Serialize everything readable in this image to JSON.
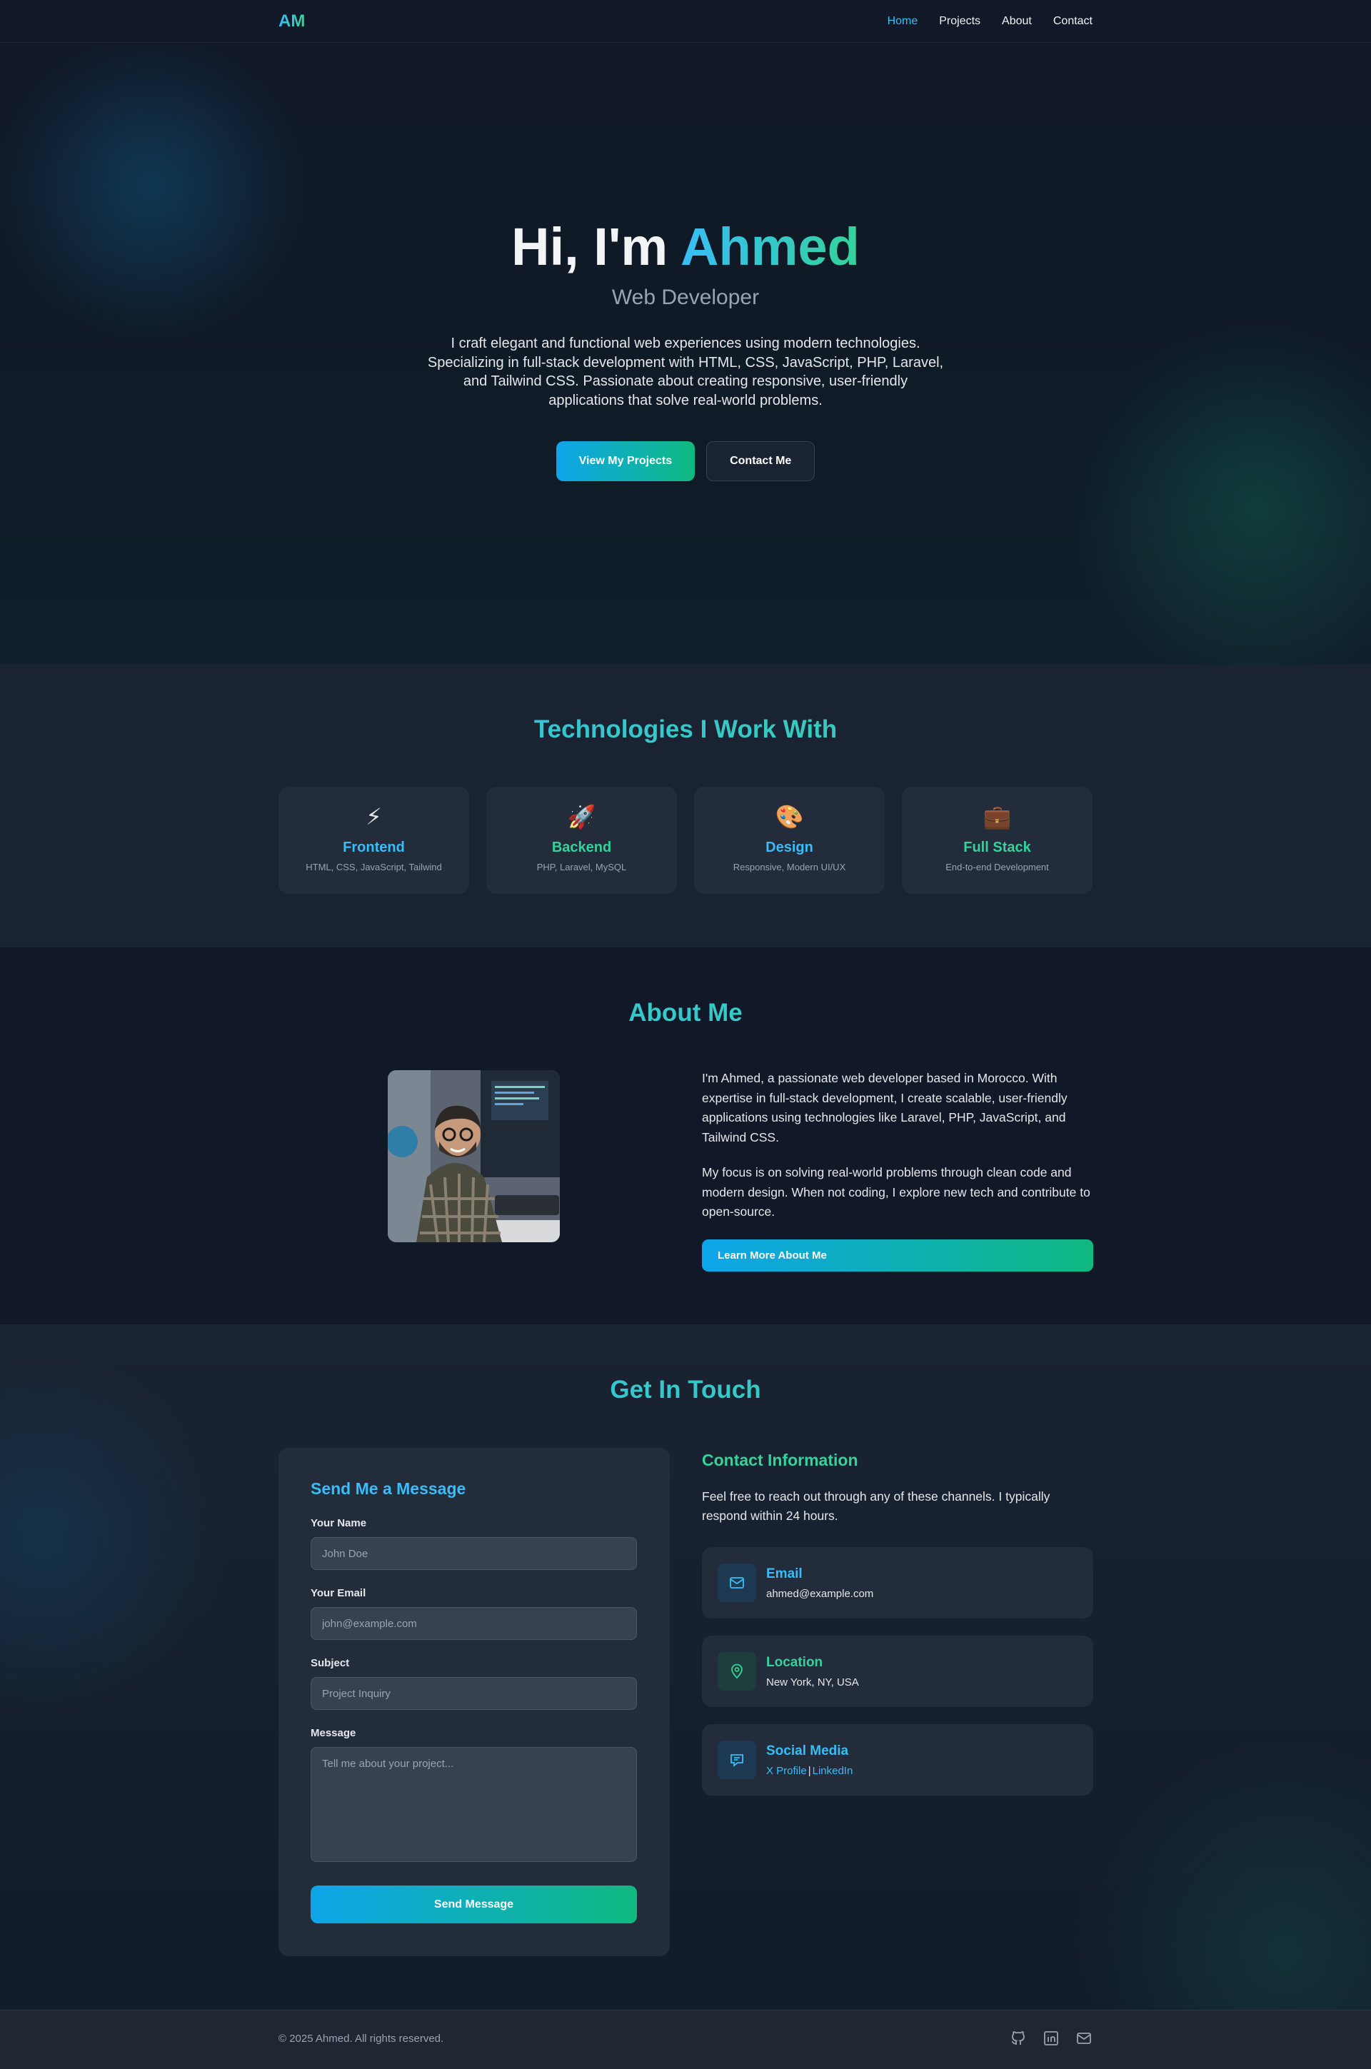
{
  "nav": {
    "logo": "AM",
    "links": [
      {
        "label": "Home",
        "active": true
      },
      {
        "label": "Projects",
        "active": false
      },
      {
        "label": "About",
        "active": false
      },
      {
        "label": "Contact",
        "active": false
      }
    ]
  },
  "hero": {
    "greeting": "Hi, I'm ",
    "name": "Ahmed",
    "role": "Web Developer",
    "intro": "I craft elegant and functional web experiences using modern technologies. Specializing in full-stack development with HTML, CSS, JavaScript, PHP, Laravel, and Tailwind CSS. Passionate about creating responsive, user-friendly applications that solve real-world problems.",
    "primary_button": "View My Projects",
    "secondary_button": "Contact Me"
  },
  "tech": {
    "title": "Technologies I Work With",
    "cards": [
      {
        "icon": "lightning-icon",
        "glyph": "⚡",
        "name": "Frontend",
        "desc": "HTML, CSS, JavaScript, Tailwind",
        "color": "#38bdf8"
      },
      {
        "icon": "rocket-icon",
        "glyph": "🚀",
        "name": "Backend",
        "desc": "PHP, Laravel, MySQL",
        "color": "#34d399"
      },
      {
        "icon": "palette-icon",
        "glyph": "🎨",
        "name": "Design",
        "desc": "Responsive, Modern UI/UX",
        "color": "#38bdf8"
      },
      {
        "icon": "briefcase-icon",
        "glyph": "💼",
        "name": "Full Stack",
        "desc": "End-to-end Development",
        "color": "#34d399"
      }
    ]
  },
  "about": {
    "title": "About Me",
    "paragraph_1": "I'm Ahmed, a passionate web developer based in Morocco. With expertise in full-stack development, I create scalable, user-friendly applications using technologies like Laravel, PHP, JavaScript, and Tailwind CSS.",
    "paragraph_2": "My focus is on solving real-world problems through clean code and modern design. When not coding, I explore new tech and contribute to open-source.",
    "button": "Learn More About Me"
  },
  "contact": {
    "title": "Get In Touch",
    "form": {
      "title": "Send Me a Message",
      "name_label": "Your Name",
      "name_placeholder": "John Doe",
      "email_label": "Your Email",
      "email_placeholder": "john@example.com",
      "subject_label": "Subject",
      "subject_placeholder": "Project Inquiry",
      "message_label": "Message",
      "message_placeholder": "Tell me about your project...",
      "submit": "Send Message"
    },
    "info": {
      "title": "Contact Information",
      "desc": "Feel free to reach out through any of these channels. I typically respond within 24 hours.",
      "email_title": "Email",
      "email_value": "ahmed@example.com",
      "location_title": "Location",
      "location_value": "New York, NY, USA",
      "social_title": "Social Media",
      "social_link_1": "X Profile",
      "social_sep": "|",
      "social_link_2": "LinkedIn"
    }
  },
  "footer": {
    "copyright": "© 2025 Ahmed. All rights reserved.",
    "icons": [
      "github-icon",
      "linkedin-icon",
      "mail-icon"
    ]
  },
  "colors": {
    "accent_blue": "#38bdf8",
    "accent_green": "#34d399",
    "background": "#111827",
    "card": "#232c3b"
  }
}
